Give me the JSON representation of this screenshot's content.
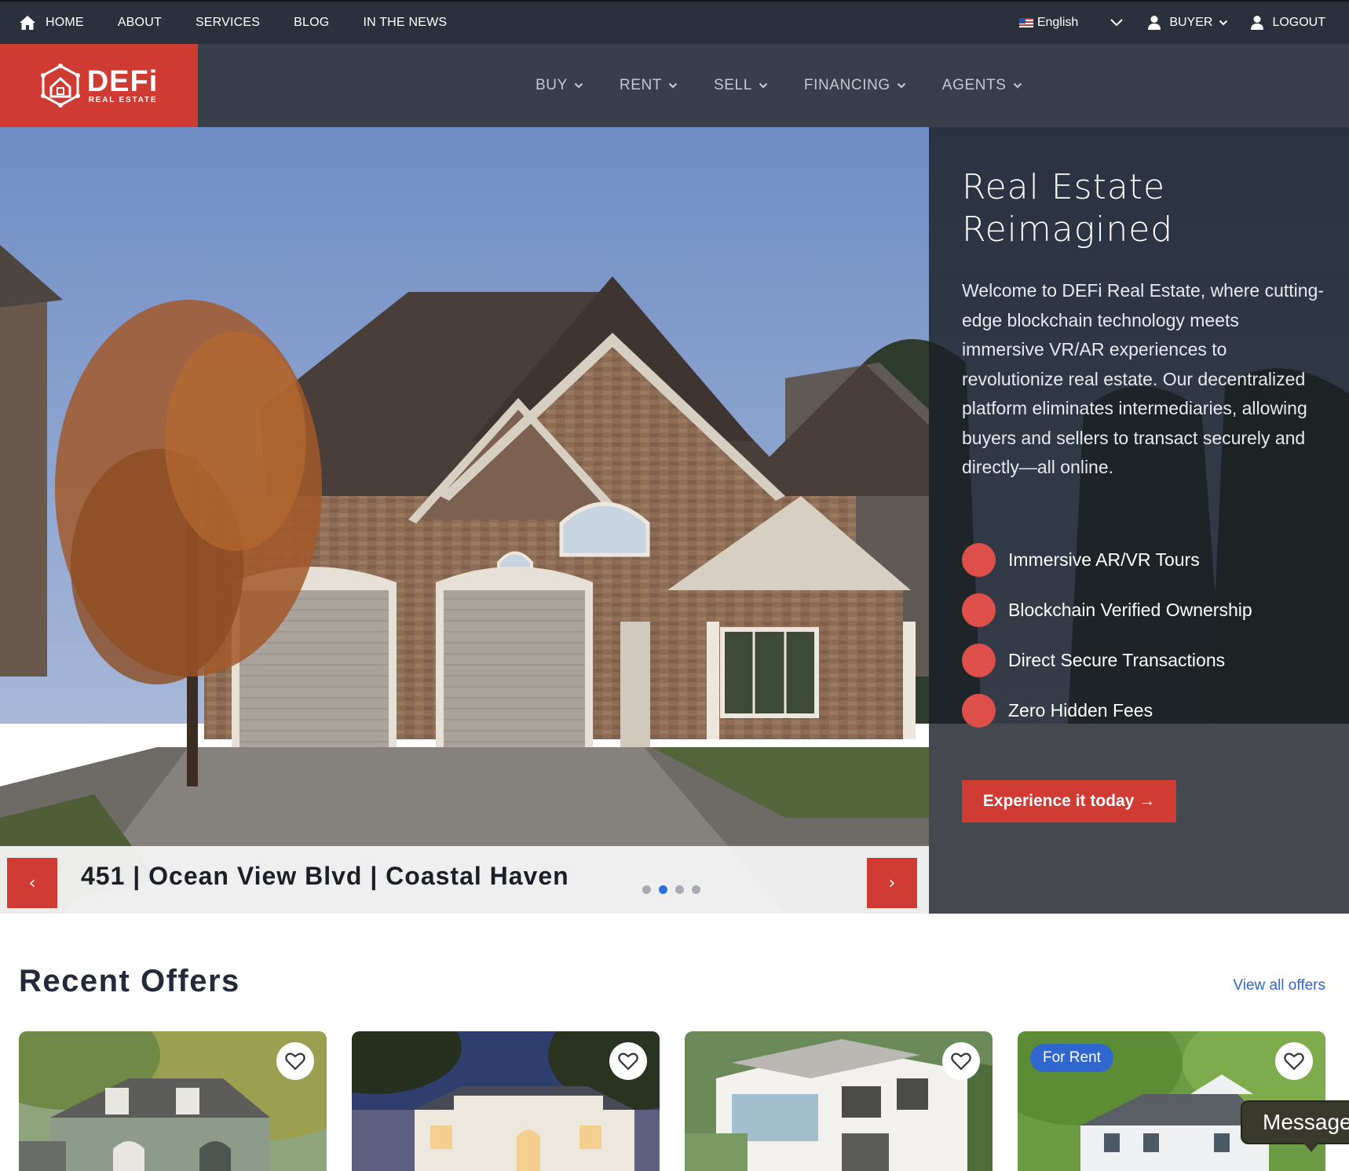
{
  "topbar": {
    "nav": [
      {
        "label": "HOME",
        "icon": "home-icon"
      },
      {
        "label": "ABOUT"
      },
      {
        "label": "SERVICES"
      },
      {
        "label": "BLOG"
      },
      {
        "label": "IN THE NEWS"
      }
    ],
    "language": {
      "label": "English",
      "icon": "us-flag-icon"
    },
    "role": "BUYER",
    "logout": "LOGOUT"
  },
  "brand": {
    "name": "DEFi",
    "tagline": "REAL ESTATE",
    "color": "#cf3b33"
  },
  "mainnav": {
    "items": [
      {
        "label": "BUY"
      },
      {
        "label": "RENT"
      },
      {
        "label": "SELL"
      },
      {
        "label": "FINANCING"
      },
      {
        "label": "AGENTS"
      }
    ]
  },
  "hero": {
    "title": "Real Estate Reimagined",
    "description": "Welcome to DEFi Real Estate, where cutting-edge blockchain technology meets immersive VR/AR experiences to revolutionize real estate. Our decentralized platform eliminates intermediaries, allowing buyers and sellers to transact securely and directly—all online.",
    "features": [
      "Immersive AR/VR Tours",
      "Blockchain Verified Ownership",
      "Direct Secure Transactions",
      "Zero Hidden Fees"
    ],
    "cta": "Experience it today →",
    "slide_caption": "451 | Ocean View Blvd | Coastal Haven",
    "slide_count": 4,
    "active_slide": 2,
    "prev_label": "‹",
    "next_label": "›"
  },
  "offers": {
    "title": "Recent Offers",
    "view_all": "View all offers",
    "cards": [
      {
        "badge": null
      },
      {
        "badge": null
      },
      {
        "badge": null
      },
      {
        "badge": "For Rent"
      }
    ]
  },
  "chat": {
    "label": "Message"
  },
  "colors": {
    "accent": "#d03c33",
    "link": "#2f66cf",
    "panel": "#1c2027",
    "nav": "#393e4b"
  }
}
